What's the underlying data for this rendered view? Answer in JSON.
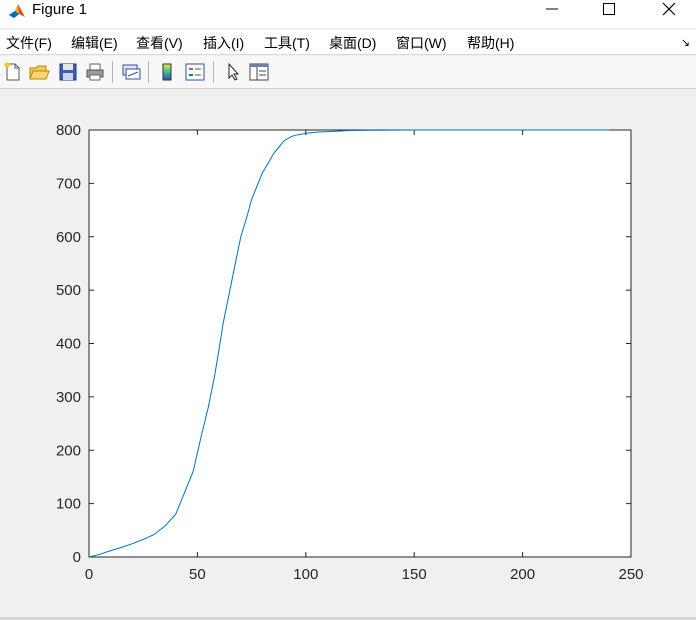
{
  "window": {
    "title": "Figure 1",
    "icon": "matlab-logo-icon",
    "controls": [
      "minimize-icon",
      "maximize-icon",
      "close-icon"
    ]
  },
  "menu": {
    "items": [
      "文件(F)",
      "编辑(E)",
      "查看(V)",
      "插入(I)",
      "工具(T)",
      "桌面(D)",
      "窗口(W)",
      "帮助(H)"
    ],
    "overflow_icon": "dock-arrow-icon"
  },
  "toolbar": {
    "buttons": [
      "new-figure-icon",
      "open-file-icon",
      "save-icon",
      "print-icon",
      "link-plot-icon",
      "insert-colorbar-icon",
      "insert-legend-icon",
      "edit-plot-arrow-icon",
      "property-inspector-icon"
    ]
  },
  "colors": {
    "line": "#0072bd",
    "axes_bg": "#ffffff",
    "figure_bg": "#f0f0f0"
  },
  "chart_data": {
    "type": "line",
    "title": "",
    "xlabel": "",
    "ylabel": "",
    "xlim": [
      0,
      250
    ],
    "ylim": [
      0,
      800
    ],
    "xticks": [
      0,
      50,
      100,
      150,
      200,
      250
    ],
    "yticks": [
      0,
      100,
      200,
      300,
      400,
      500,
      600,
      700,
      800
    ],
    "grid": false,
    "legend": "none",
    "series": [
      {
        "x": [
          0,
          5,
          10,
          15,
          20,
          25,
          30,
          35,
          40,
          42,
          45,
          48,
          50,
          52,
          55,
          58,
          60,
          62,
          65,
          68,
          70,
          73,
          75,
          78,
          80,
          83,
          85,
          88,
          90,
          93,
          95,
          98,
          100,
          105,
          110,
          115,
          120,
          130,
          150,
          200,
          240
        ],
        "y": [
          0,
          5,
          12,
          18,
          25,
          33,
          42,
          58,
          80,
          100,
          130,
          160,
          195,
          230,
          280,
          340,
          390,
          440,
          500,
          560,
          600,
          640,
          670,
          700,
          720,
          740,
          755,
          770,
          780,
          787,
          790,
          792,
          794,
          796,
          797,
          798,
          799,
          799.5,
          800,
          800,
          800
        ]
      }
    ]
  }
}
